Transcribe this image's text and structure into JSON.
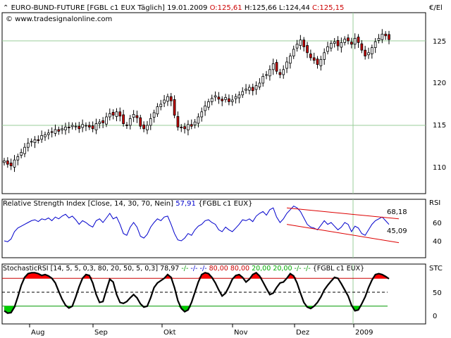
{
  "price_panel": {
    "instrument": "EURO-BUND-FUTURE",
    "contract": "[FGBL c1 EUX",
    "period": "Täglich]",
    "date": "19.01.2009",
    "open": "O:125,61",
    "high": "H:125,66",
    "low": "L:124,44",
    "close": "C:125,15",
    "website": "© www.tradesignalonline.com",
    "unit": "€/El",
    "y_ticks": [
      "125",
      "120",
      "115",
      "110"
    ]
  },
  "rsi_panel": {
    "title": "Relative Strength Index [Close, 14, 30, 70, Nein]",
    "value": "57,91",
    "source": "{FGBL c1 EUX}",
    "short_label": "RSI",
    "y_ticks": [
      "60",
      "40"
    ],
    "upper_channel_label": "68,18",
    "lower_channel_label": "45,09"
  },
  "stoch_panel": {
    "title": "StochasticRSI [14, 5, 5, 0,3, 80, 20, 50, 5, 0,3]",
    "value": "78,97",
    "seg1": "-/-",
    "seg2": "-/-",
    "seg3": "-/-",
    "v80a": "80,00",
    "v80b": "80,00",
    "v20a": "20,00",
    "v20b": "20,00",
    "seg4": "-/-",
    "seg5": "-/-",
    "source": "{FGBL c1 EUX}",
    "short_label": "STC",
    "y_ticks": [
      "50",
      "0"
    ]
  },
  "x_axis": {
    "labels": [
      "Aug",
      "Sep",
      "Okt",
      "Nov",
      "Dez",
      "2009"
    ]
  },
  "colors": {
    "up_candle": "#ffffff",
    "down_candle": "#cc0000",
    "rsi_line": "#0000cc",
    "channel": "#dd0000",
    "overbought_fill": "#ff0000",
    "oversold_fill": "#00cc00",
    "upper_band": "#cc0000",
    "lower_band": "#009900",
    "grid": "#99cc99"
  },
  "chart_data": [
    {
      "type": "candlestick",
      "title": "EURO-BUND-FUTURE [FGBL c1 EUX Täglich] 19.01.2009",
      "ylabel": "€/El",
      "ylim": [
        107,
        128
      ],
      "x": [
        "Aug",
        "Sep",
        "Okt",
        "Nov",
        "Dez",
        "2009"
      ],
      "close_series": [
        110.8,
        110.4,
        110.2,
        110.9,
        111.3,
        111.8,
        112.4,
        112.9,
        113.1,
        113.3,
        113.2,
        113.8,
        113.9,
        114.1,
        114.2,
        114.5,
        114.3,
        114.6,
        114.8,
        114.7,
        115.0,
        114.9,
        114.6,
        115.1,
        115.0,
        114.8,
        114.6,
        115.2,
        115.4,
        115.3,
        116.0,
        116.4,
        116.2,
        116.6,
        116.1,
        115.2,
        115.0,
        115.8,
        116.3,
        115.9,
        114.9,
        114.6,
        115.0,
        115.8,
        116.5,
        117.2,
        117.5,
        118.0,
        118.4,
        117.9,
        116.2,
        114.8,
        114.7,
        114.6,
        115.1,
        114.9,
        115.4,
        116.0,
        116.6,
        117.3,
        117.8,
        118.2,
        118.5,
        118.1,
        117.9,
        118.3,
        117.8,
        118.0,
        118.4,
        118.6,
        119.0,
        119.3,
        119.5,
        119.1,
        119.7,
        120.0,
        120.8,
        121.0,
        121.6,
        122.3,
        121.4,
        121.0,
        121.6,
        122.5,
        123.2,
        124.0,
        124.6,
        125.1,
        124.3,
        123.6,
        123.0,
        122.7,
        122.2,
        122.8,
        123.6,
        124.3,
        124.7,
        124.9,
        124.4,
        124.8,
        125.2,
        125.0,
        124.6,
        125.3,
        124.8,
        123.9,
        123.2,
        123.6,
        124.2,
        124.9,
        125.3,
        125.8,
        125.6,
        125.15
      ]
    },
    {
      "type": "line",
      "title": "Relative Strength Index [Close, 14, 30, 70, Nein] 57,91 {FGBL c1 EUX}",
      "ylabel": "RSI",
      "ylim": [
        30,
        82
      ],
      "series": [
        {
          "name": "RSI",
          "values": [
            40,
            39,
            42,
            50,
            54,
            56,
            58,
            60,
            62,
            63,
            61,
            64,
            63,
            65,
            62,
            66,
            64,
            67,
            69,
            65,
            67,
            63,
            58,
            62,
            60,
            57,
            55,
            62,
            64,
            60,
            65,
            70,
            64,
            66,
            58,
            48,
            46,
            55,
            60,
            55,
            45,
            43,
            47,
            55,
            60,
            64,
            62,
            66,
            67,
            58,
            48,
            41,
            40,
            43,
            48,
            46,
            52,
            56,
            58,
            62,
            63,
            60,
            58,
            52,
            50,
            55,
            52,
            50,
            54,
            58,
            63,
            62,
            64,
            61,
            67,
            70,
            72,
            68,
            74,
            76,
            66,
            60,
            64,
            70,
            74,
            78,
            76,
            72,
            65,
            58,
            55,
            54,
            52,
            57,
            62,
            58,
            60,
            56,
            52,
            55,
            60,
            58,
            50,
            56,
            54,
            48,
            46,
            52,
            58,
            62,
            64,
            66,
            62,
            57.91
          ]
        }
      ],
      "annotations": [
        "68,18",
        "45,09"
      ]
    },
    {
      "type": "line",
      "title": "StochasticRSI [14, 5, 5, 0,3, 80, 20, 50, 5, 0,3] 78,97",
      "ylabel": "STC",
      "ylim": [
        -8,
        110
      ],
      "bands": {
        "upper": 80,
        "middle": 50,
        "lower": 20
      },
      "series": [
        {
          "name": "StochasticRSI",
          "values": [
            10,
            5,
            6,
            18,
            40,
            65,
            82,
            90,
            92,
            92,
            90,
            86,
            88,
            85,
            80,
            70,
            52,
            35,
            22,
            16,
            20,
            40,
            62,
            80,
            88,
            86,
            70,
            45,
            28,
            30,
            55,
            78,
            72,
            45,
            28,
            26,
            30,
            38,
            45,
            38,
            25,
            18,
            20,
            38,
            60,
            70,
            75,
            80,
            88,
            82,
            60,
            32,
            15,
            8,
            12,
            28,
            50,
            72,
            88,
            92,
            90,
            82,
            70,
            55,
            42,
            48,
            62,
            78,
            86,
            88,
            82,
            72,
            78,
            88,
            92,
            85,
            72,
            58,
            45,
            48,
            60,
            70,
            72,
            80,
            90,
            85,
            70,
            48,
            28,
            18,
            15,
            20,
            28,
            40,
            55,
            65,
            74,
            82,
            80,
            68,
            55,
            42,
            22,
            10,
            12,
            25,
            40,
            60,
            76,
            88,
            90,
            88,
            84,
            78.97
          ]
        }
      ]
    }
  ]
}
